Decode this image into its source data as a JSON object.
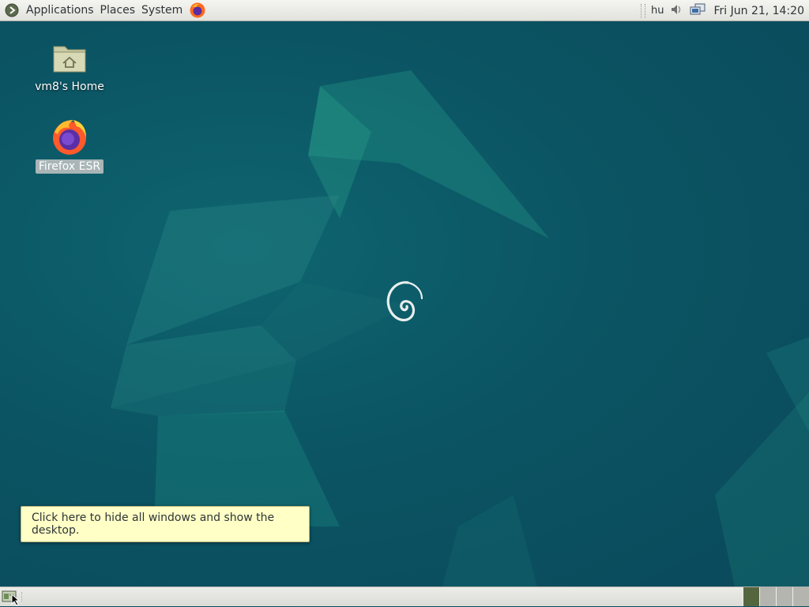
{
  "top_panel": {
    "menus": [
      "Applications",
      "Places",
      "System"
    ],
    "keyboard_layout": "hu",
    "clock": "Fri Jun 21, 14:20",
    "launchers": {
      "browser_icon": "firefox-icon"
    },
    "tray_icons": [
      "volume-icon",
      "network-icon"
    ]
  },
  "desktop": {
    "icons": [
      {
        "label": "vm8's Home",
        "icon": "home-folder-icon"
      },
      {
        "label": "Firefox ESR",
        "icon": "firefox-icon",
        "selected": true
      }
    ],
    "wallpaper_logo": "debian-swirl-icon"
  },
  "tooltip": {
    "text": "Click here to hide all windows and show the desktop."
  },
  "bottom_panel": {
    "show_desktop_icon": "show-desktop-icon",
    "workspaces": {
      "count": 4,
      "active_index": 0
    }
  },
  "colors": {
    "desktop_bg": "#0b4f5f",
    "panel_bg": "#e8e8e4",
    "tooltip_bg": "#ffffc6",
    "workspace_active": "#55663f",
    "workspace_inactive": "#b5b5b0"
  }
}
